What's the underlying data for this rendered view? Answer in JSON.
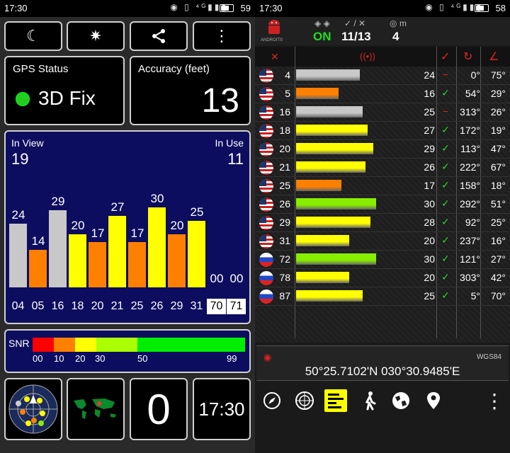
{
  "left": {
    "status_bar": {
      "time": "17:30",
      "battery": "59",
      "icons": "◉ ▯ ⁴ᴳ▮▮▮"
    },
    "toolbar": {
      "buttons": [
        {
          "name": "night-mode-button",
          "icon": "moon-icon",
          "glyph": "☾"
        },
        {
          "name": "compass-button",
          "icon": "compass-rose-icon",
          "glyph": "✷"
        },
        {
          "name": "share-button",
          "icon": "share-icon",
          "glyph": "⋖"
        },
        {
          "name": "menu-button",
          "icon": "overflow-menu-icon",
          "glyph": "⋮"
        }
      ]
    },
    "gps_status": {
      "label": "GPS Status",
      "value": "3D Fix",
      "dot_color": "#22cc22"
    },
    "accuracy": {
      "label": "Accuracy (feet)",
      "value": "13"
    },
    "satellites": {
      "in_view_label": "In View",
      "in_view": "19",
      "in_use_label": "In Use",
      "in_use": "11"
    },
    "chart_data": {
      "type": "bar",
      "categories": [
        "04",
        "05",
        "16",
        "18",
        "20",
        "21",
        "25",
        "26",
        "29",
        "31",
        "70",
        "71"
      ],
      "values": [
        24,
        14,
        29,
        20,
        17,
        27,
        17,
        30,
        20,
        25,
        0,
        0
      ],
      "labels": [
        "24",
        "14",
        "29",
        "20",
        "17",
        "27",
        "17",
        "30",
        "20",
        "25",
        "00",
        "00"
      ],
      "colors": [
        "#c8c8c8",
        "#ff8000",
        "#c8c8c8",
        "#ffff00",
        "#ff8000",
        "#ffff00",
        "#ff8000",
        "#ffff00",
        "#ff8000",
        "#ffff00",
        "#ffffff",
        "#ffffff"
      ],
      "inverted_labels": [
        "70",
        "71"
      ],
      "ylim": [
        0,
        40
      ]
    },
    "snr": {
      "label": "SNR",
      "ticks": [
        "00",
        "10",
        "20",
        "30",
        "50",
        "99"
      ],
      "colors": [
        "#ff0000",
        "#ff8000",
        "#ffff00",
        "#aaff00",
        "#00ee00"
      ]
    },
    "bottom": {
      "clock": "17:30",
      "count": "0"
    }
  },
  "right": {
    "status_bar": {
      "time": "17:30",
      "battery": "58",
      "icons": "◉ ▯ ⁴ᴳ▮▮▮"
    },
    "header": {
      "brand": "ANDROITS",
      "gps_state": "ON",
      "sats": "11/13",
      "range": "4",
      "unit": "m"
    },
    "columns": {
      "prn_icon": "satellite-icon",
      "signal_icon": "signal-icon",
      "used_icon": "check-icon",
      "azimuth_icon": "azimuth-icon",
      "elevation_icon": "elevation-icon"
    },
    "rows": [
      {
        "prn": "4",
        "snr": "24",
        "bar": 24,
        "color": "#c8c8c8",
        "used": "−",
        "az": "0°",
        "el": "75°",
        "flag": "us"
      },
      {
        "prn": "5",
        "snr": "16",
        "bar": 16,
        "color": "#ff8000",
        "used": "✓",
        "az": "54°",
        "el": "29°",
        "flag": "us"
      },
      {
        "prn": "16",
        "snr": "25",
        "bar": 25,
        "color": "#c8c8c8",
        "used": "−",
        "az": "313°",
        "el": "26°",
        "flag": "us"
      },
      {
        "prn": "18",
        "snr": "27",
        "bar": 27,
        "color": "#ffff00",
        "used": "✓",
        "az": "172°",
        "el": "19°",
        "flag": "us"
      },
      {
        "prn": "20",
        "snr": "29",
        "bar": 29,
        "color": "#ffff00",
        "used": "✓",
        "az": "113°",
        "el": "47°",
        "flag": "us"
      },
      {
        "prn": "21",
        "snr": "26",
        "bar": 26,
        "color": "#ffff00",
        "used": "✓",
        "az": "222°",
        "el": "67°",
        "flag": "us"
      },
      {
        "prn": "25",
        "snr": "17",
        "bar": 17,
        "color": "#ff8000",
        "used": "✓",
        "az": "158°",
        "el": "18°",
        "flag": "us"
      },
      {
        "prn": "26",
        "snr": "30",
        "bar": 30,
        "color": "#88ee00",
        "used": "✓",
        "az": "292°",
        "el": "51°",
        "flag": "us"
      },
      {
        "prn": "29",
        "snr": "28",
        "bar": 28,
        "color": "#ffff00",
        "used": "✓",
        "az": "92°",
        "el": "25°",
        "flag": "us"
      },
      {
        "prn": "31",
        "snr": "20",
        "bar": 20,
        "color": "#ffff00",
        "used": "✓",
        "az": "237°",
        "el": "16°",
        "flag": "us"
      },
      {
        "prn": "72",
        "snr": "30",
        "bar": 30,
        "color": "#88ee00",
        "used": "✓",
        "az": "121°",
        "el": "27°",
        "flag": "ru"
      },
      {
        "prn": "78",
        "snr": "20",
        "bar": 20,
        "color": "#ffff00",
        "used": "✓",
        "az": "303°",
        "el": "42°",
        "flag": "ru"
      },
      {
        "prn": "87",
        "snr": "25",
        "bar": 25,
        "color": "#ffff00",
        "used": "✓",
        "az": "5°",
        "el": "70°",
        "flag": "ru"
      }
    ],
    "coords": {
      "datum": "WGS84",
      "value": "50°25.7102'N   030°30.9485'E"
    },
    "nav": [
      {
        "name": "compass-nav",
        "icon": "compass-icon",
        "glyph": "⊘"
      },
      {
        "name": "radar-nav",
        "icon": "radar-icon",
        "glyph": "◎"
      },
      {
        "name": "bars-nav",
        "icon": "signal-bars-icon",
        "glyph": "▤"
      },
      {
        "name": "walk-nav",
        "icon": "walking-icon",
        "glyph": "🚶"
      },
      {
        "name": "globe-nav",
        "icon": "globe-icon",
        "glyph": "◍"
      },
      {
        "name": "pin-nav",
        "icon": "location-pin-icon",
        "glyph": "⚲"
      },
      {
        "name": "overflow-nav",
        "icon": "overflow-menu-icon",
        "glyph": "⋮"
      }
    ]
  }
}
